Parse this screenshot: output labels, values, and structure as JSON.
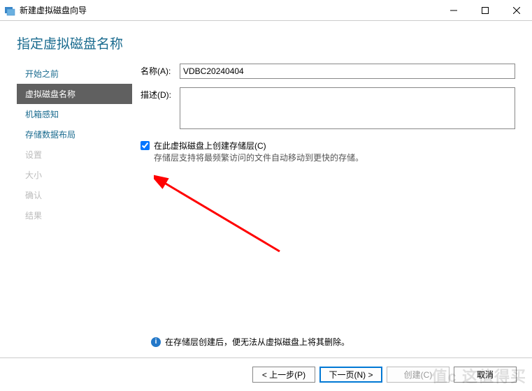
{
  "titlebar": {
    "title": "新建虚拟磁盘向导"
  },
  "heading": "指定虚拟磁盘名称",
  "sidebar": {
    "items": [
      {
        "label": "开始之前",
        "state": "enabled"
      },
      {
        "label": "虚拟磁盘名称",
        "state": "active"
      },
      {
        "label": "机箱感知",
        "state": "enabled"
      },
      {
        "label": "存储数据布局",
        "state": "enabled"
      },
      {
        "label": "设置",
        "state": "disabled"
      },
      {
        "label": "大小",
        "state": "disabled"
      },
      {
        "label": "确认",
        "state": "disabled"
      },
      {
        "label": "结果",
        "state": "disabled"
      }
    ]
  },
  "form": {
    "name_label": "名称(A):",
    "name_value": "VDBC20240404",
    "desc_label": "描述(D):",
    "desc_value": "",
    "checkbox_checked": true,
    "checkbox_label": "在此虚拟磁盘上创建存储层(C)",
    "checkbox_desc": "存储层支持将最频繁访问的文件自动移动到更快的存储。"
  },
  "info": "在存储层创建后，便无法从虚拟磁盘上将其删除。",
  "footer": {
    "prev": "< 上一步(P)",
    "next": "下一页(N) >",
    "create": "创建(C)",
    "cancel": "取消"
  },
  "watermark": "值c 这值得买"
}
